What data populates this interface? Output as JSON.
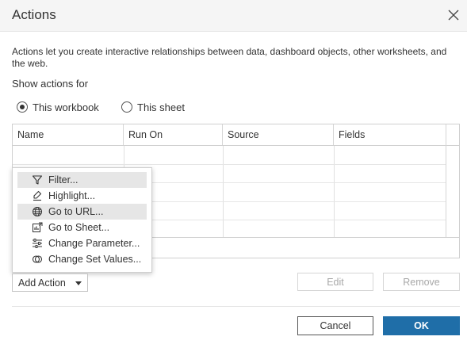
{
  "dialog": {
    "title": "Actions",
    "description": "Actions let you create interactive relationships between data, dashboard objects, other worksheets, and the web.",
    "show_actions_for_label": "Show actions for"
  },
  "radios": [
    {
      "label": "This workbook",
      "selected": true
    },
    {
      "label": "This sheet",
      "selected": false
    }
  ],
  "table": {
    "columns": [
      "Name",
      "Run On",
      "Source",
      "Fields"
    ],
    "rows": []
  },
  "add_action": {
    "label": "Add Action",
    "menu": [
      {
        "label": "Filter...",
        "icon": "filter-icon",
        "highlighted": true
      },
      {
        "label": "Highlight...",
        "icon": "highlighter-icon",
        "highlighted": false
      },
      {
        "label": "Go to URL...",
        "icon": "globe-icon",
        "highlighted": true
      },
      {
        "label": "Go to Sheet...",
        "icon": "sheet-icon",
        "highlighted": false
      },
      {
        "label": "Change Parameter...",
        "icon": "sliders-icon",
        "highlighted": false
      },
      {
        "label": "Change Set Values...",
        "icon": "set-icon",
        "highlighted": false
      }
    ]
  },
  "buttons": {
    "edit": "Edit",
    "remove": "Remove",
    "cancel": "Cancel",
    "ok": "OK"
  },
  "colors": {
    "primary": "#1f6ea8",
    "titlebar": "#f5f5f5",
    "menu_highlight": "#e6e6e6"
  }
}
